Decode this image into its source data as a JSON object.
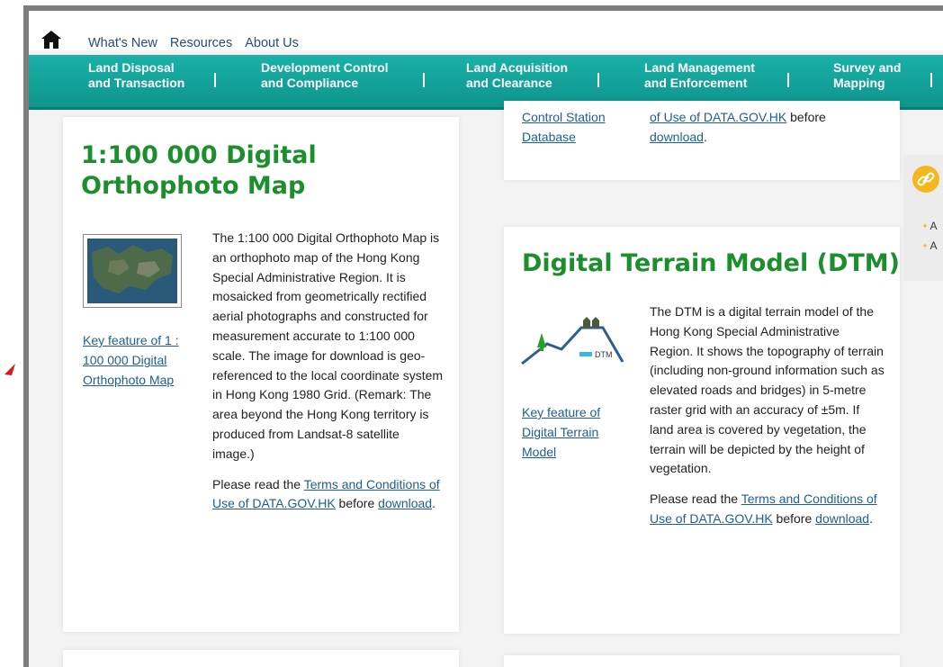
{
  "topnav": {
    "links": [
      "What's New",
      "Resources",
      "About Us"
    ]
  },
  "menubar": {
    "items": [
      {
        "line1": "Land Disposal",
        "line2": "and Transaction"
      },
      {
        "line1": "Development Control",
        "line2": "and Compliance"
      },
      {
        "line1": "Land Acquisition",
        "line2": "and Clearance"
      },
      {
        "line1": "Land Management",
        "line2": "and Enforcement"
      },
      {
        "line1": "Survey and",
        "line2": "Mapping"
      }
    ],
    "separator": "|"
  },
  "card_top_right_partial": {
    "left_link_lines": [
      "Control Station",
      "Database"
    ],
    "right_text_line1_link": "of Use of DATA.GOV.HK",
    "right_text_line1_after": " before",
    "right_download": "download",
    "right_period": "."
  },
  "card_orthophoto": {
    "title_line1": "1:100 000 Digital",
    "title_line2": "Orthophoto Map",
    "key_feature_link": "Key feature of 1 : 100 000 Digital Orthophoto Map",
    "description": "The 1:100 000 Digital Orthophoto Map is an orthophoto map of the Hong Kong Special Administrative Region. It is mosaicked from geometrically rectified aerial photographs and constructed for measurement accurate to 1:100 000 scale. The image for download is geo-referenced to the local coordinate system in Hong Kong 1980 Grid. (Remark: The area beyond the Hong Kong territory is produced from Landsat-8 satellite image.)",
    "terms_before": "Please read the ",
    "terms_link": "Terms and Conditions of Use of DATA.GOV.HK",
    "terms_after": " before ",
    "download_link": "download",
    "period": "."
  },
  "card_dtm": {
    "title": "Digital Terrain Model (DTM)",
    "icon_label": "DTM",
    "key_feature_link": "Key feature of Digital Terrain Model",
    "description": "The DTM is a digital terrain model of the Hong Kong Special Administrative Region. It shows the topography of terrain (including non-ground information such as elevated roads and bridges) in 5-metre raster grid with an accuracy of ±5m. If land area is covered by vegetation, the terrain will be depicted by the height of vegetation.",
    "terms_before": "Please read the ",
    "terms_link": "Terms and Conditions of Use of DATA.GOV.HK",
    "terms_after": " before ",
    "download_link": "download",
    "period": "."
  },
  "side_panel": {
    "bullets": [
      "A",
      "A"
    ]
  },
  "colors": {
    "menubar": "#14a69d",
    "title_green": "#1b8f2c",
    "link_blue": "#1c5f96",
    "accent_yellow": "#f4b81f"
  }
}
